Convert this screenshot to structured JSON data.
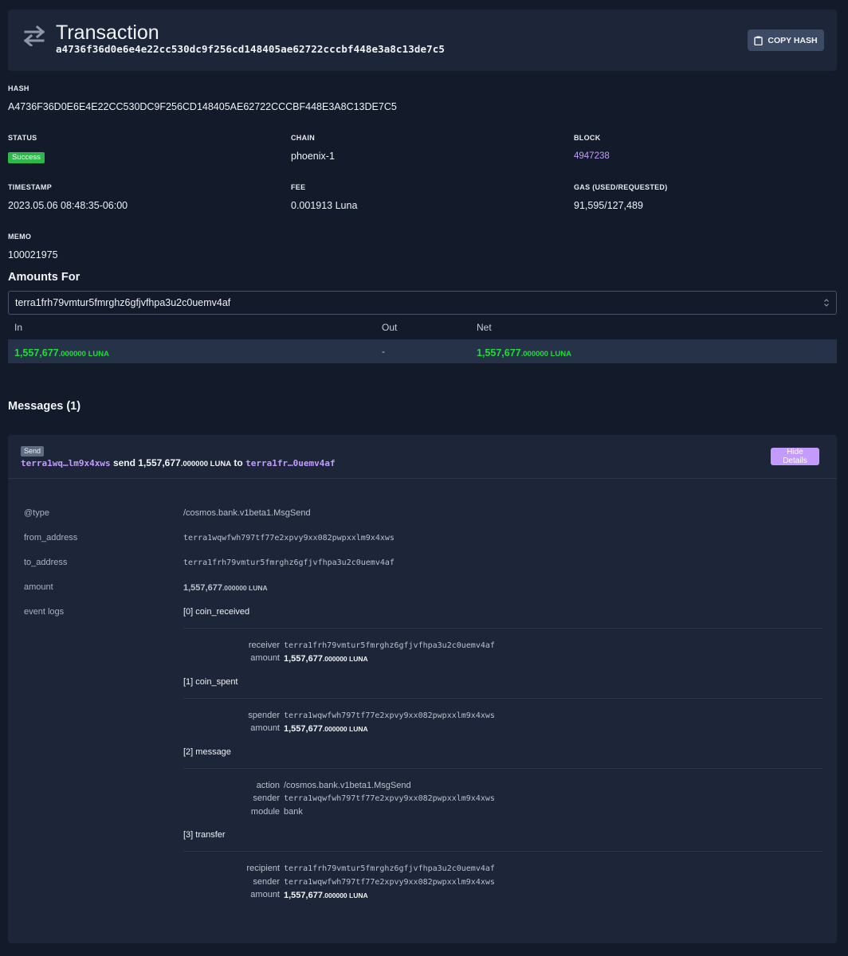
{
  "header": {
    "title": "Transaction",
    "hash": "a4736f36d0e6e4e22cc530dc9f256cd148405ae62722cccbf448e3a8c13de7c5",
    "copy_label": "COPY HASH",
    "icon": "arrows-exchange-icon"
  },
  "fields": {
    "hash_label": "HASH",
    "hash_value": "A4736F36D0E6E4E22CC530DC9F256CD148405AE62722CCCBF448E3A8C13DE7C5",
    "status_label": "STATUS",
    "status_value": "Success",
    "chain_label": "CHAIN",
    "chain_value": "phoenix-1",
    "block_label": "BLOCK",
    "block_value": "4947238",
    "timestamp_label": "TIMESTAMP",
    "timestamp_value": "2023.05.06 08:48:35-06:00",
    "fee_label": "FEE",
    "fee_value": "0.001913 Luna",
    "gas_label": "GAS (USED/REQUESTED)",
    "gas_value": "91,595/127,489",
    "memo_label": "MEMO",
    "memo_value": "100021975"
  },
  "amounts": {
    "title": "Amounts For",
    "selected_address": "terra1frh79vmtur5fmrghz6gfjvfhpa3u2c0uemv4af",
    "col_in": "In",
    "col_out": "Out",
    "col_net": "Net",
    "in_whole": "1,557,677",
    "in_frac": ".000000 LUNA",
    "out": "-",
    "net_whole": "1,557,677",
    "net_frac": ".000000 LUNA"
  },
  "messages": {
    "title": "Messages (1)",
    "badge": "Send",
    "from_short": "terra1wq…lm9x4xws",
    "verb": "send",
    "amount_whole": "1,557,677",
    "amount_frac": ".000000 LUNA",
    "to_word": "to",
    "to_short": "terra1fr…0uemv4af",
    "hide_label": "Hide Details",
    "details": {
      "type_key": "@type",
      "type_value": "/cosmos.bank.v1beta1.MsgSend",
      "from_key": "from_address",
      "from_value": "terra1wqwfwh797tf77e2xpvy9xx082pwpxxlm9x4xws",
      "to_key": "to_address",
      "to_value": "terra1frh79vmtur5fmrghz6gfjvfhpa3u2c0uemv4af",
      "amount_key": "amount",
      "amount_whole": "1,557,677",
      "amount_frac": ".000000 LUNA",
      "events_key": "event logs"
    },
    "events": {
      "e0_title": "[0] coin_received",
      "e0_k1": "receiver",
      "e0_v1": "terra1frh79vmtur5fmrghz6gfjvfhpa3u2c0uemv4af",
      "e0_k2": "amount",
      "e0_v2_whole": "1,557,677",
      "e0_v2_frac": ".000000 LUNA",
      "e1_title": "[1] coin_spent",
      "e1_k1": "spender",
      "e1_v1": "terra1wqwfwh797tf77e2xpvy9xx082pwpxxlm9x4xws",
      "e1_k2": "amount",
      "e1_v2_whole": "1,557,677",
      "e1_v2_frac": ".000000 LUNA",
      "e2_title": "[2] message",
      "e2_k1": "action",
      "e2_v1": "/cosmos.bank.v1beta1.MsgSend",
      "e2_k2": "sender",
      "e2_v2": "terra1wqwfwh797tf77e2xpvy9xx082pwpxxlm9x4xws",
      "e2_k3": "module",
      "e2_v3": "bank",
      "e3_title": "[3] transfer",
      "e3_k1": "recipient",
      "e3_v1": "terra1frh79vmtur5fmrghz6gfjvfhpa3u2c0uemv4af",
      "e3_k2": "sender",
      "e3_v2": "terra1wqwfwh797tf77e2xpvy9xx082pwpxxlm9x4xws",
      "e3_k3": "amount",
      "e3_v3_whole": "1,557,677",
      "e3_v3_frac": ".000000 LUNA"
    }
  },
  "colors": {
    "background": "#131b2b",
    "card": "#1c2638",
    "link": "#c39bff",
    "success": "#2eb84b",
    "amount_green": "#1fdc3a"
  }
}
